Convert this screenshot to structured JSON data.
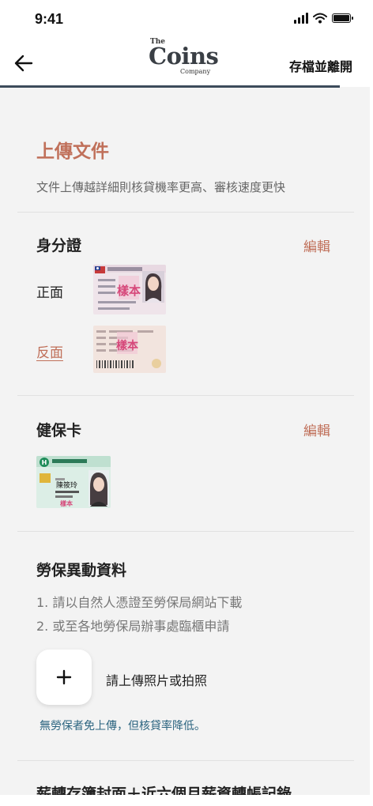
{
  "status_bar": {
    "time": "9:41"
  },
  "header": {
    "logo": {
      "the": "The",
      "coins": "Coins",
      "company": "Company"
    },
    "save_exit_label": "存檔並離開"
  },
  "page": {
    "title": "上傳文件",
    "subtitle": "文件上傳越詳細則核貸機率更高、審核速度更快"
  },
  "id_card": {
    "title": "身分證",
    "edit_label": "編輯",
    "front_label": "正面",
    "back_label": "反面",
    "stamp_text": "樣本"
  },
  "health_card": {
    "title": "健保卡",
    "edit_label": "編輯",
    "card_name": "陳筱玲",
    "stamp_text": "樣本"
  },
  "labor_insurance": {
    "title": "勞保異動資料",
    "instructions": [
      "1. 請以自然人憑證至勞保局網站下載",
      "2. 或至各地勞保局辦事處臨櫃申請"
    ],
    "upload_label": "請上傳照片或拍照",
    "note": "無勞保者免上傳，但核貸率降低。"
  },
  "next_section": {
    "title": "薪轉存簿封面＋近六個月薪資轉帳記錄"
  },
  "colors": {
    "accent": "#c0705a",
    "note": "#2d6580",
    "header_line": "#3c4b5b"
  }
}
